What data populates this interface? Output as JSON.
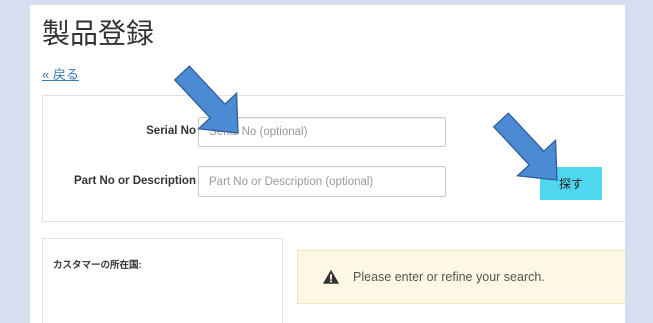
{
  "page": {
    "title": "製品登録",
    "back_link": "« 戻る"
  },
  "search_form": {
    "serial": {
      "label": "Serial No",
      "placeholder": "Serial No (optional)",
      "value": ""
    },
    "part": {
      "label": "Part No or Description",
      "placeholder": "Part No or Description (optional)",
      "value": ""
    },
    "search_button": "探す"
  },
  "filters": {
    "country_label": "カスタマーの所在国:"
  },
  "alert": {
    "icon": "warning-icon",
    "message": "Please enter or refine your search."
  },
  "colors": {
    "background": "#d6deef",
    "button": "#4fd7ef",
    "link": "#337ab7",
    "alert_background": "#fcf8e3",
    "alert_border": "#f4e4bc",
    "annotation_arrow": "#4b8bd3",
    "annotation_arrow_outline": "#2f5f99"
  }
}
